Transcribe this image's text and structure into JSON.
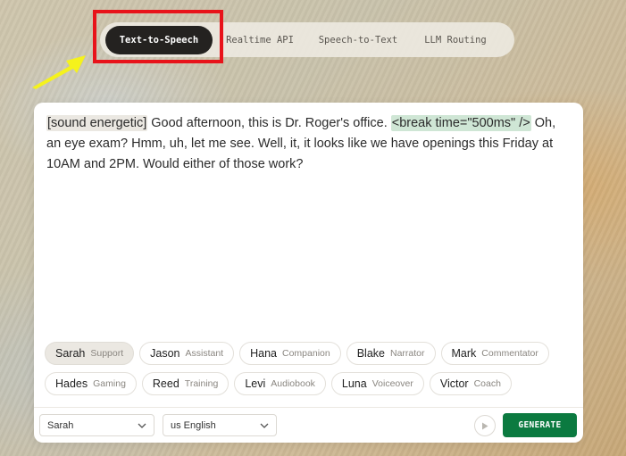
{
  "nav": {
    "tabs": [
      {
        "label": "Text-to-Speech",
        "active": true
      },
      {
        "label": "Realtime API",
        "active": false
      },
      {
        "label": "Speech-to-Text",
        "active": false
      },
      {
        "label": "LLM Routing",
        "active": false
      }
    ]
  },
  "annotation": {
    "highlight_color": "#e8131a",
    "arrow_color": "#f5f21c"
  },
  "editor": {
    "sound_tag": "[sound energetic]",
    "text_1": " Good afternoon, this is Dr. Roger's office. ",
    "break_tag": "<break time=\"500ms\" />",
    "text_2": " Oh, an eye exam? Hmm, uh, let me see. Well, it, it looks like we have openings this Friday at 10AM and 2PM. Would either of those work?"
  },
  "voices": {
    "row1": [
      {
        "name": "Sarah",
        "role": "Support",
        "selected": true
      },
      {
        "name": "Jason",
        "role": "Assistant"
      },
      {
        "name": "Hana",
        "role": "Companion"
      },
      {
        "name": "Blake",
        "role": "Narrator"
      },
      {
        "name": "Mark",
        "role": "Commentator"
      }
    ],
    "row2": [
      {
        "name": "Hades",
        "role": "Gaming"
      },
      {
        "name": "Reed",
        "role": "Training"
      },
      {
        "name": "Levi",
        "role": "Audiobook"
      },
      {
        "name": "Luna",
        "role": "Voiceover"
      },
      {
        "name": "Victor",
        "role": "Coach"
      }
    ]
  },
  "footer": {
    "voice_select": "Sarah",
    "language_select": "us English",
    "play_icon": "play-icon",
    "generate_label": "GENERATE",
    "accent": "#0b7a40"
  }
}
